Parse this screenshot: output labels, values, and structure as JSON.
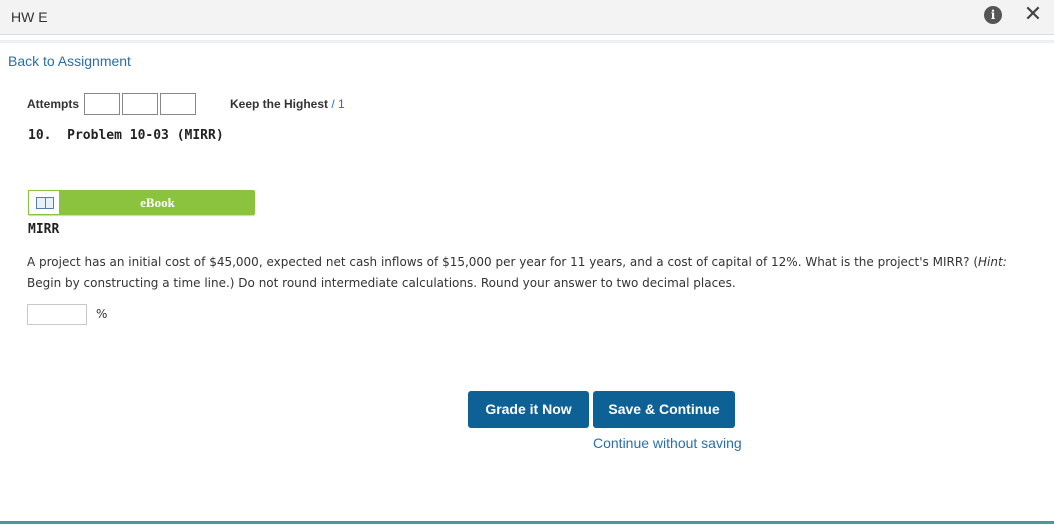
{
  "header": {
    "title": "HW E",
    "info_icon": "info-icon",
    "close_icon": "close-icon",
    "info_glyph": "i",
    "close_glyph": "✕"
  },
  "nav": {
    "back_link": "Back to Assignment"
  },
  "attempts": {
    "label": "Attempts",
    "boxes": [
      "",
      "",
      ""
    ],
    "keep_label": "Keep the Highest",
    "keep_separator": " / ",
    "keep_value": "1"
  },
  "problem": {
    "title": "10.  Problem 10-03 (MIRR)",
    "ebook_label": "eBook",
    "ebook_icon": "book-icon",
    "section": "MIRR",
    "text_main": "A project has an initial cost of $45,000, expected net cash inflows of $15,000 per year for 11 years, and a cost of capital of 12%. What is the project's MIRR? (",
    "hint": "Hint:",
    "text_end": " Begin by constructing a time line.) Do not round intermediate calculations. Round your answer to two decimal places.",
    "answer_value": "",
    "unit": "%"
  },
  "actions": {
    "grade_button": "Grade it Now",
    "save_button": "Save & Continue",
    "continue_link": "Continue without saving"
  },
  "colors": {
    "primary_button": "#0e6195",
    "ebook_green": "#8bc33f",
    "link": "#2b6da8"
  }
}
